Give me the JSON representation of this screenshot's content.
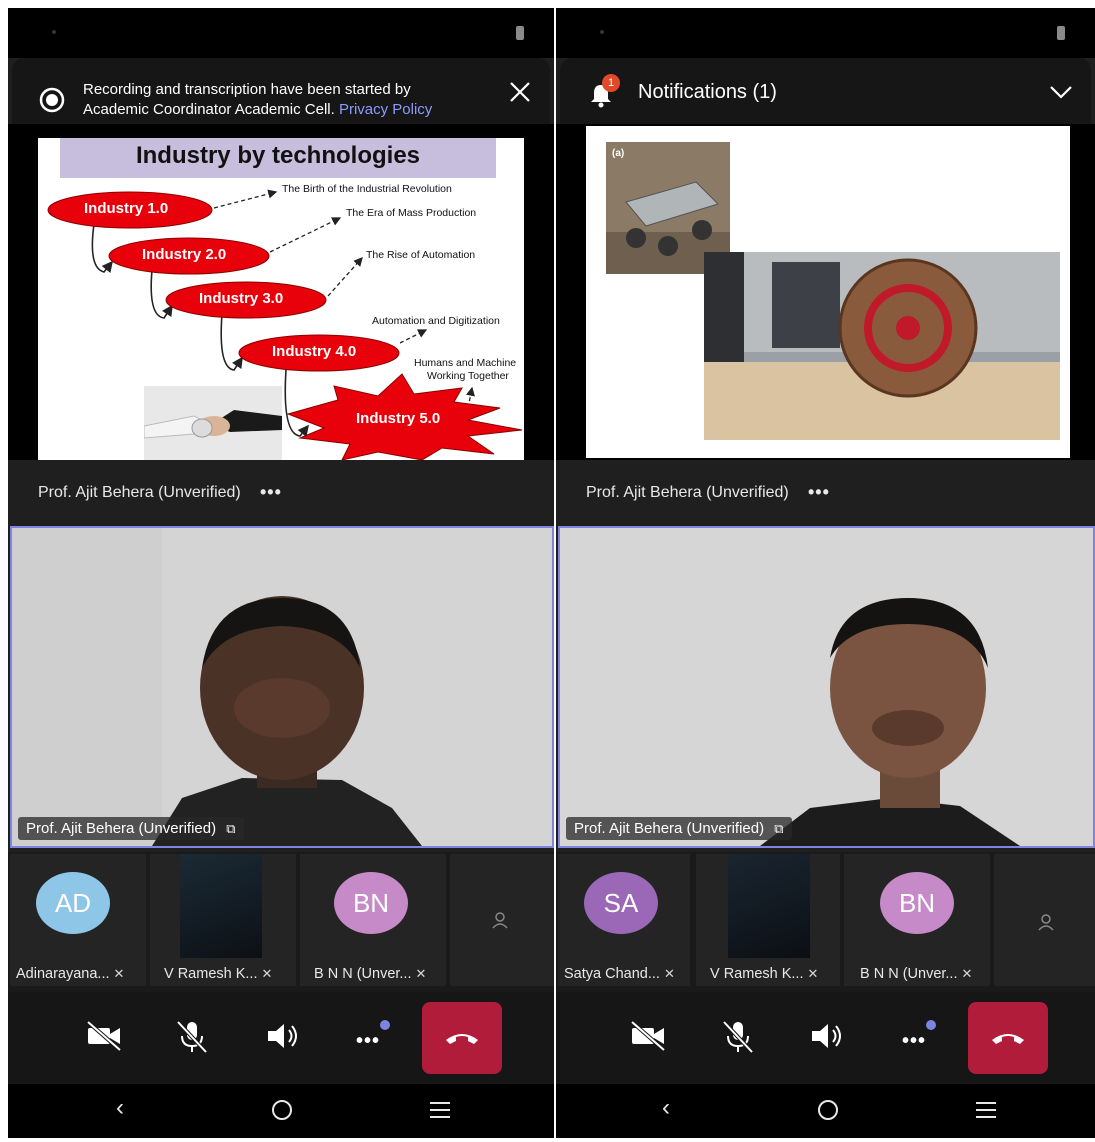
{
  "left": {
    "banner": {
      "text_line1": "Recording and transcription have been started by",
      "text_line2": "Academic Coordinator Academic Cell.",
      "link": "Privacy Policy"
    },
    "slide": {
      "title": "Industry by technologies",
      "stages": [
        {
          "label": "Industry 1.0",
          "caption": "The Birth of the Industrial Revolution"
        },
        {
          "label": "Industry 2.0",
          "caption": "The Era of Mass Production"
        },
        {
          "label": "Industry 3.0",
          "caption": "The Rise of Automation"
        },
        {
          "label": "Industry 4.0",
          "caption": "Automation and Digitization"
        },
        {
          "label": "Industry 5.0",
          "caption_line1": "Humans and Machine",
          "caption_line2": "Working Together"
        }
      ]
    },
    "presenter": "Prof. Ajit Behera (Unverified)",
    "more": "•••",
    "video_name": "Prof. Ajit Behera (Unverified)",
    "participants": [
      {
        "initials": "AD",
        "name": "Adinarayana...",
        "color": "#8ec6e8"
      },
      {
        "initials": "",
        "name": "V Ramesh K...",
        "color": ""
      },
      {
        "initials": "BN",
        "name": "B N N (Unver...",
        "color": "#c58ac7"
      }
    ]
  },
  "right": {
    "notifications": {
      "badge": "1",
      "title": "Notifications (1)"
    },
    "slide": {
      "panel_label": "(a)"
    },
    "presenter": "Prof. Ajit Behera (Unverified)",
    "more": "•••",
    "video_name": "Prof. Ajit Behera (Unverified)",
    "participants": [
      {
        "initials": "SA",
        "name": "Satya Chand...",
        "color": "#9b68b7"
      },
      {
        "initials": "",
        "name": "V Ramesh K...",
        "color": ""
      },
      {
        "initials": "BN",
        "name": "B N N (Unver...",
        "color": "#c58ac7"
      }
    ]
  },
  "colors": {
    "accent": "#7f84e0",
    "hangup": "#b01c3a",
    "link": "#8b9bff",
    "notify_badge": "#e04a2a"
  }
}
